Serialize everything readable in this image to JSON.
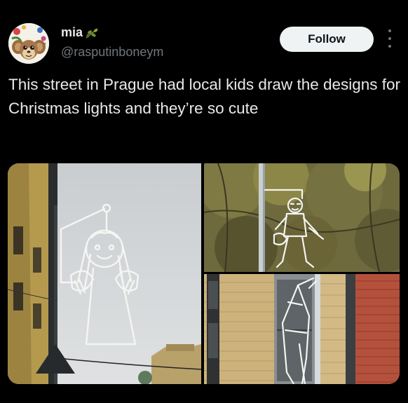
{
  "tweet": {
    "author_name": "mia",
    "name_emoji": "olive-branch-icon",
    "handle": "@rasputinboneym",
    "follow_label": "Follow",
    "text": "This street in Prague had local kids draw the designs for Christmas lights and they’re so cute"
  },
  "media": {
    "photos": [
      "angel-light-photo",
      "violin-figure-light-photo",
      "figure-light-on-brick-building-photo"
    ]
  },
  "colors": {
    "background": "#000000",
    "text": "#e7e9ea",
    "secondary_text": "#71767b",
    "follow_button": "#eff3f4"
  }
}
